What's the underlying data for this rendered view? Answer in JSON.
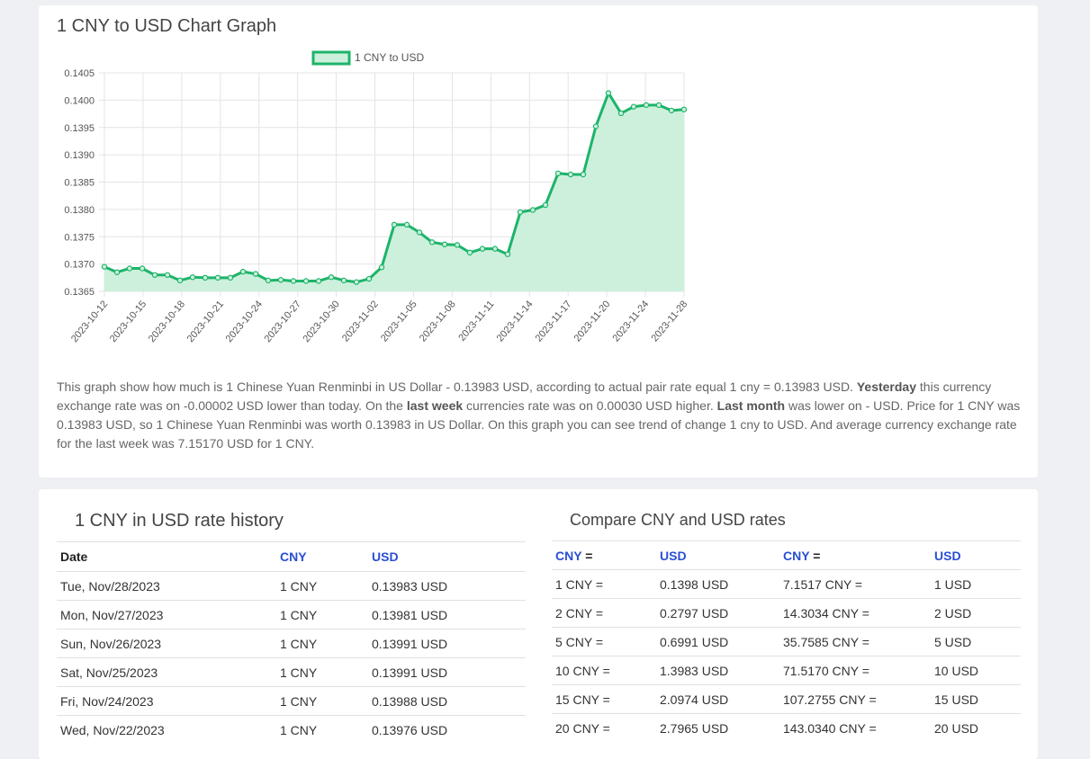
{
  "chart_section": {
    "title": "1 CNY to USD Chart Graph",
    "description": {
      "p1": "This graph show how much is 1 Chinese Yuan Renminbi in US Dollar - 0.13983 USD, according to actual pair rate equal 1 cny = 0.13983 USD. ",
      "b1": "Yesterday",
      "p2": " this currency exchange rate was on -0.00002 USD lower than today. On the ",
      "b2": "last week",
      "p3": " currencies rate was on 0.00030 USD higher. ",
      "b3": "Last month",
      "p4": " was lower on - USD. Price for 1 CNY was 0.13983 USD, so 1 Chinese Yuan Renminbi was worth 0.13983 in US Dollar. On this graph you can see trend of change 1 cny to USD. And average currency exchange rate for the last week was 7.15170 USD for 1 CNY."
    }
  },
  "chart_data": {
    "type": "area",
    "title": "",
    "xlabel": "",
    "ylabel": "",
    "legend": "top-center",
    "grid": true,
    "ylim": [
      0.1365,
      0.1405
    ],
    "yticks": [
      "0.1405",
      "0.1400",
      "0.1395",
      "0.1390",
      "0.1385",
      "0.1380",
      "0.1375",
      "0.1370",
      "0.1365"
    ],
    "xticks": [
      "2023-10-12",
      "2023-10-15",
      "2023-10-18",
      "2023-10-21",
      "2023-10-24",
      "2023-10-27",
      "2023-10-30",
      "2023-11-02",
      "2023-11-05",
      "2023-11-08",
      "2023-11-11",
      "2023-11-14",
      "2023-11-17",
      "2023-11-20",
      "2023-11-24",
      "2023-11-28"
    ],
    "series": [
      {
        "name": "1 CNY to USD",
        "color": "#1db46a",
        "fill": "#cdf0dc",
        "values": [
          0.13695,
          0.13685,
          0.13692,
          0.13692,
          0.1368,
          0.1368,
          0.1367,
          0.13676,
          0.13675,
          0.13675,
          0.13675,
          0.13686,
          0.13682,
          0.1367,
          0.13671,
          0.13669,
          0.13669,
          0.13669,
          0.13676,
          0.1367,
          0.13667,
          0.13673,
          0.13694,
          0.13772,
          0.13772,
          0.13758,
          0.1374,
          0.13736,
          0.13735,
          0.13721,
          0.13728,
          0.13728,
          0.13718,
          0.13795,
          0.13799,
          0.13808,
          0.13866,
          0.13864,
          0.13864,
          0.13952,
          0.14013,
          0.13976,
          0.13988,
          0.13991,
          0.13991,
          0.13981,
          0.13983
        ]
      }
    ]
  },
  "history": {
    "title": "1 CNY in USD rate history",
    "headers": [
      "Date",
      "CNY",
      "USD"
    ],
    "rows": [
      [
        "Tue, Nov/28/2023",
        "1 CNY",
        "0.13983 USD"
      ],
      [
        "Mon, Nov/27/2023",
        "1 CNY",
        "0.13981 USD"
      ],
      [
        "Sun, Nov/26/2023",
        "1 CNY",
        "0.13991 USD"
      ],
      [
        "Sat, Nov/25/2023",
        "1 CNY",
        "0.13991 USD"
      ],
      [
        "Fri, Nov/24/2023",
        "1 CNY",
        "0.13988 USD"
      ],
      [
        "Wed, Nov/22/2023",
        "1 CNY",
        "0.13976 USD"
      ]
    ]
  },
  "compare": {
    "title": "Compare CNY and USD rates",
    "headers": [
      {
        "cur": "CNY",
        "suffix": " ="
      },
      {
        "cur": "USD",
        "suffix": ""
      },
      {
        "cur": "CNY",
        "suffix": " ="
      },
      {
        "cur": "USD",
        "suffix": ""
      }
    ],
    "rows": [
      [
        "1 CNY =",
        "0.1398 USD",
        "7.1517 CNY =",
        "1 USD"
      ],
      [
        "2 CNY =",
        "0.2797 USD",
        "14.3034 CNY =",
        "2 USD"
      ],
      [
        "5 CNY =",
        "0.6991 USD",
        "35.7585 CNY =",
        "5 USD"
      ],
      [
        "10 CNY =",
        "1.3983 USD",
        "71.5170 CNY =",
        "10 USD"
      ],
      [
        "15 CNY =",
        "2.0974 USD",
        "107.2755 CNY =",
        "15 USD"
      ],
      [
        "20 CNY =",
        "2.7965 USD",
        "143.0340 CNY =",
        "20 USD"
      ]
    ]
  }
}
